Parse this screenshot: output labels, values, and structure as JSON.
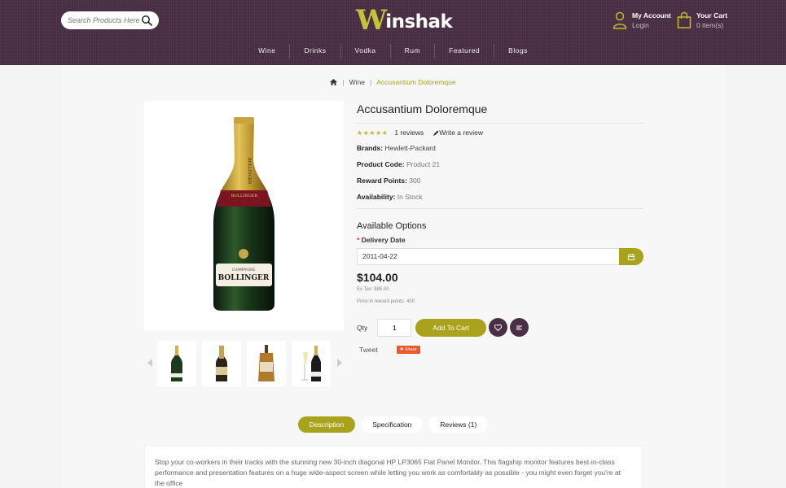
{
  "search": {
    "placeholder": "Search Products Here"
  },
  "brand": {
    "logo_first": "W",
    "logo_rest": "inshak"
  },
  "account": {
    "title": "My Account",
    "subtitle": "Login"
  },
  "cart": {
    "title": "Your Cart",
    "count": "0 item(s)"
  },
  "nav": {
    "items": [
      "Wine",
      "Drinks",
      "Vodka",
      "Rum",
      "Featured",
      "Blogs"
    ]
  },
  "breadcrumb": {
    "items": [
      "Wine",
      "Accusantium Doloremque"
    ]
  },
  "product": {
    "title": "Accusantium Doloremque",
    "rating_stars": "★★★★★",
    "reviews": "1 reviews",
    "write_review": "Write a review",
    "brands_label": "Brands:",
    "brands_value": "Hewlett-Packard",
    "code_label": "Product Code:",
    "code_value": "Product 21",
    "points_label": "Reward Points:",
    "points_value": "300",
    "availability_label": "Availability:",
    "availability_value": "In Stock",
    "options_title": "Available Options",
    "delivery_label": "Delivery Date",
    "delivery_value": "2011-04-22",
    "price": "$104.00",
    "ex_tax": "Ex Tax: $85.00",
    "reward_price": "Price in reward points: 400",
    "qty_label": "Qty",
    "qty_value": "1",
    "add_to_cart": "Add To Cart",
    "tweet": "Tweet",
    "share": "Share",
    "bottle_label_top": "CHAMPAGNE",
    "bottle_label_brand": "BOLLINGER"
  },
  "tabs": [
    {
      "label": "Description",
      "active": true
    },
    {
      "label": "Specification",
      "active": false
    },
    {
      "label": "Reviews (1)",
      "active": false
    }
  ],
  "description": "Stop your co-workers in their tracks with the stunning new 30-inch diagonal HP LP3065 Flat Panel Monitor. This flagship monitor features best-in-class performance and presentation features on a huge wide-aspect screen while letting you work as comfortably as possible - you might even forget you're at the office",
  "colors": {
    "accent": "#a8a21d",
    "header": "#4a2f44"
  }
}
